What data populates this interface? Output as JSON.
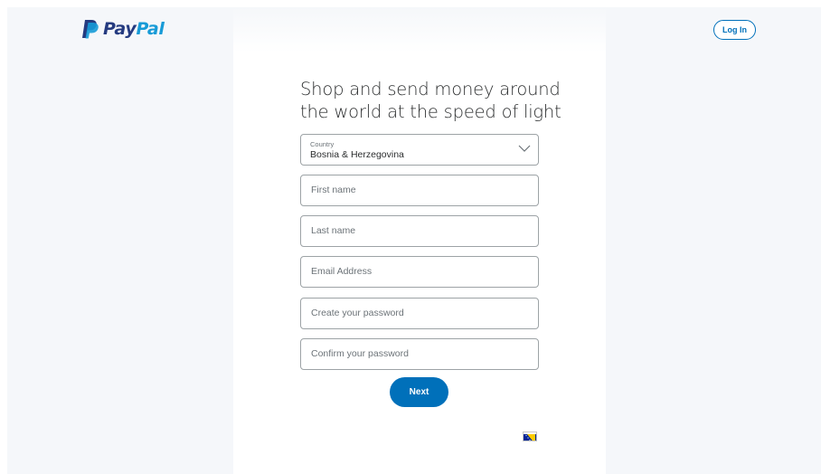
{
  "brand": {
    "logo_text_a": "Pay",
    "logo_text_b": "Pal"
  },
  "header": {
    "login_label": "Log In"
  },
  "main": {
    "headline": "Shop and send money around the world at the speed of light",
    "country": {
      "label": "Country",
      "value": "Bosnia & Herzegovina"
    },
    "fields": {
      "first_name": "First name",
      "last_name": "Last name",
      "email": "Email Address",
      "password": "Create your password",
      "confirm_password": "Confirm your password"
    },
    "next_label": "Next"
  },
  "colors": {
    "brand_dark": "#253b80",
    "brand_light": "#179bd7",
    "accent": "#0070ba",
    "page_bg": "#f5f7fa"
  },
  "icons": {
    "logo": "paypal-p-icon",
    "dropdown": "chevron-down-icon",
    "language_flag": "bosnia-flag-icon"
  }
}
